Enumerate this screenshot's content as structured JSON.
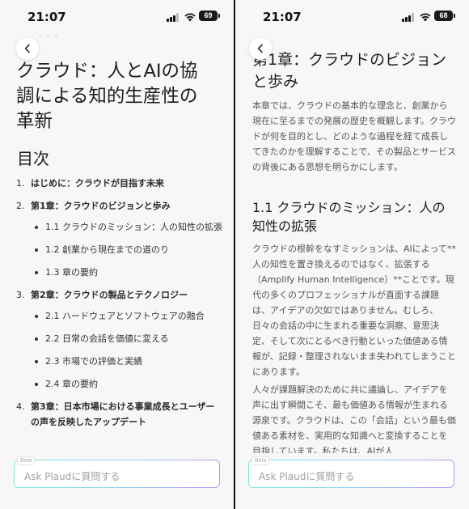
{
  "status": {
    "time": "21:07",
    "battery_left": "69",
    "battery_right": "68"
  },
  "left": {
    "faded_header": "- - -",
    "title": "クラウド：人とAIの協調による知的生産性の革新",
    "toc_heading": "目次",
    "toc": [
      {
        "num": "1.",
        "label": "はじめに：クラウドが目指す未来",
        "subs": []
      },
      {
        "num": "2.",
        "label": "第1章：クラウドのビジョンと歩み",
        "subs": [
          "1.1 クラウドのミッション：人の知性の拡張",
          "1.2 創業から現在までの道のり",
          "1.3 章の要約"
        ]
      },
      {
        "num": "3.",
        "label": "第2章：クラウドの製品とテクノロジー",
        "subs": [
          "2.1 ハードウェアとソフトウェアの融合",
          "2.2 日常の会話を価値に変える",
          "2.3 市場での評価と実績",
          "2.4 章の要約"
        ]
      },
      {
        "num": "4.",
        "label": "第3章：日本市場における事業成長とユーザーの声を反映したアップデート",
        "subs": []
      }
    ]
  },
  "ask": {
    "placeholder": "Ask Plaudに質問する",
    "beta_label": "Beta"
  },
  "right": {
    "chapter_title": "第1章：クラウドのビジョンと歩み",
    "intro": "本章では、クラウドの基本的な理念と、創業から現在に至るまでの発展の歴史を概観します。クラウドが何を目的とし、どのような過程を経て成長してきたのかを理解することで、その製品とサービスの背後にある思想を明らかにします。",
    "section_title": "1.1 クラウドのミッション：人の知性の拡張",
    "mission_p1": "クラウドの根幹をなすミッションは、AIによって**人の知性を置き換えるのではなく、拡張する（Amplify Human Intelligence）**ことです。現代の多くのプロフェッショナルが直面する課題は、アイデアの欠如ではありません。むしろ、日々の会話の中に生まれる重要な洞察、意思決定、そして次にとるべき行動といった価値ある情報が、記録・整理されないまま失われてしまうことにあります。",
    "mission_p2": "人々が課題解決のために共に議論し、アイデアを声に出す瞬間こそ、最も価値ある情報が生まれる源泉です。クラウドは、この「会話」という最も価値ある素材を、実用的な知識へと変換することを目指しています。私たちは、AIが人"
  },
  "colors": {
    "ask_gradient_start": "#7ee8d8",
    "ask_gradient_end": "#b99af5",
    "pane_bg": "#f7f7f7"
  },
  "icons": {
    "back": "chevron-left-icon",
    "signal": "signal-icon",
    "wifi": "wifi-icon",
    "battery": "battery-icon"
  }
}
